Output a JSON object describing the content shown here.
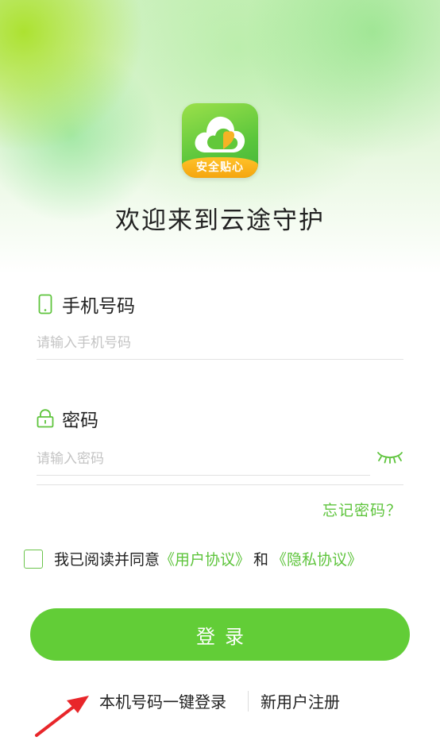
{
  "app": {
    "logo_badge": "安全贴心",
    "welcome": "欢迎来到云途守护"
  },
  "form": {
    "phone_label": "手机号码",
    "phone_placeholder": "请输入手机号码",
    "phone_value": "",
    "password_label": "密码",
    "password_placeholder": "请输入密码",
    "password_value": "",
    "forgot": "忘记密码？"
  },
  "agreement": {
    "checked": false,
    "prefix": "我已阅读并同意",
    "user_agreement": "《用户协议》",
    "conjunction": "和",
    "privacy_policy": "《隐私协议》"
  },
  "actions": {
    "login": "登录",
    "one_click_login": "本机号码一键登录",
    "register": "新用户注册"
  },
  "colors": {
    "accent": "#62cd37",
    "link": "#5ec43c",
    "badge": "#f5a50e",
    "annotation_arrow": "#e8262a"
  },
  "icons": [
    "cloud-heart-icon",
    "phone-icon",
    "lock-icon",
    "eye-closed-icon",
    "red-arrow-icon"
  ]
}
